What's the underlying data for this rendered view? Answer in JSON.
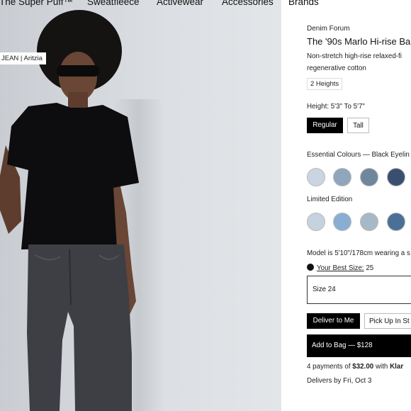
{
  "nav": {
    "items": [
      "The Super Puff™",
      "Sweatfleece",
      "Activewear",
      "Accessories",
      "Brands"
    ]
  },
  "image": {
    "tag": "JEAN | Aritzia"
  },
  "product": {
    "brand": "Denim Forum",
    "title": "The '90s Marlo Hi-rise Ba",
    "desc_line1": "Non-stretch high-rise relaxed-fi",
    "desc_line2": "regenerative cotton",
    "heights_badge": "2 Heights",
    "height_label": "Height: 5'3\" To 5'7\"",
    "height_options": [
      "Regular",
      "Tall"
    ],
    "essential_label": "Essential Colours — Black Eyelin",
    "essential_colours": [
      "#c9d5e0",
      "#8fa6bd",
      "#6f879c",
      "#3a4f70"
    ],
    "limited_label": "Limited Edition",
    "limited_colours": [
      "#c6d2dd",
      "#8aaed2",
      "#a7b8c6",
      "#4c6f98"
    ],
    "model_text": "Model is 5'10\"/178cm wearing a s",
    "best_size_link": "Your Best Size:",
    "best_size_value": "25",
    "size_select": "Size 24",
    "delivery_options": [
      "Deliver to Me",
      "Pick Up In St"
    ],
    "add_to_bag": "Add to Bag — $128",
    "payments_prefix": "4 payments of ",
    "payments_amount": "$32.00",
    "payments_suffix": " with ",
    "payments_brand": "Klar",
    "delivers_by": "Delivers by Fri, Oct 3"
  },
  "colors": {
    "accent": "#000000"
  }
}
